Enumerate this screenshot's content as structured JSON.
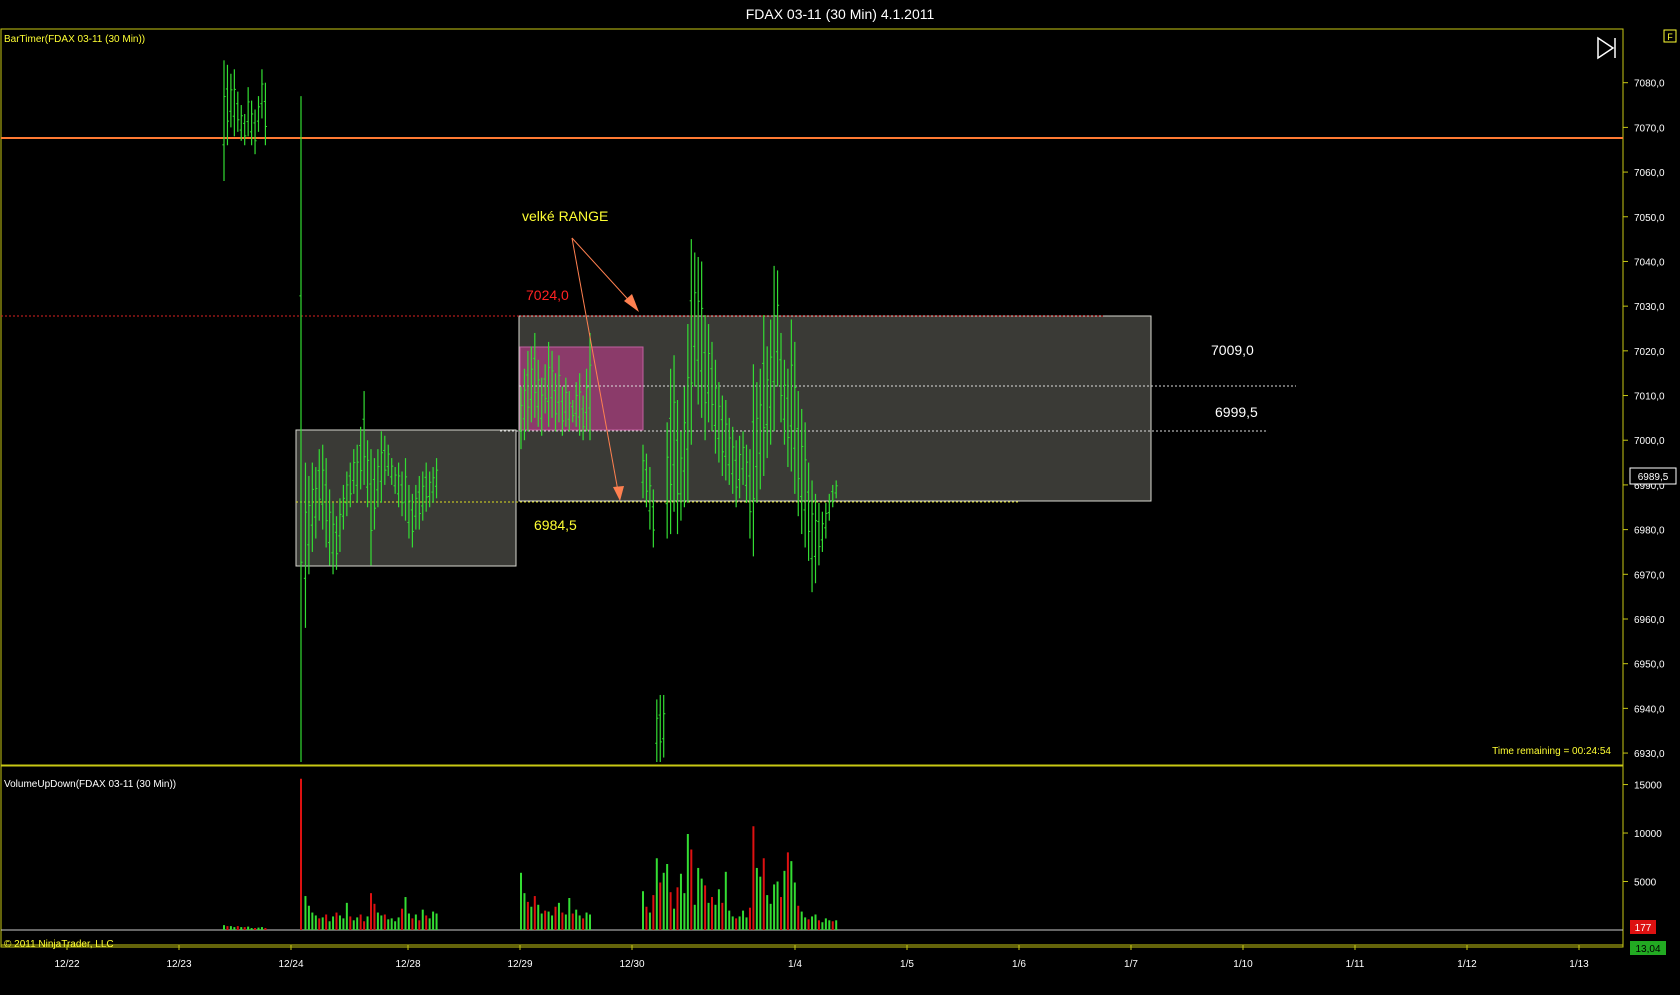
{
  "window_title": "FDAX 03-11 (30 Min)  4.1.2011",
  "copyright": "© 2011 NinjaTrader, LLC",
  "colors": {
    "background": "#000000",
    "frame": "#c8c814",
    "up_bar": "#33dd33",
    "down_bar": "#dd1111",
    "orange_line": "#ff7a33",
    "red_dotted": "#dd2222",
    "label_yellow": "#ffff33",
    "label_red": "#ff2222",
    "range_fill": "#444440",
    "pink_fill": "#a03c78",
    "arrow": "#ff8050"
  },
  "price_panel": {
    "indicator_label": "BarTimer(FDAX 03-11 (30 Min))",
    "time_remaining": "Time remaining = 00:24:54",
    "current_price": "6989,5",
    "yaxis_ticks": [
      "7080,0",
      "7070,0",
      "7060,0",
      "7050,0",
      "7040,0",
      "7030,0",
      "7020,0",
      "7010,0",
      "7000,0",
      "6990,0",
      "6980,0",
      "6970,0",
      "6960,0",
      "6950,0",
      "6940,0",
      "6930,0"
    ],
    "ylim": [
      6928,
      7090
    ],
    "annotation_text": "velké RANGE",
    "level_labels": {
      "high": "7024,0",
      "mid": "7009,0",
      "low_mid": "6999,5",
      "low": "6984,5"
    },
    "levels": {
      "orange": 7062.5,
      "high": 7024.0,
      "mid": 7009.0,
      "low_mid": 6999.5,
      "low": 6984.5
    },
    "menu_glyph": "F"
  },
  "volume_panel": {
    "indicator_label": "VolumeUpDown(FDAX 03-11 (30 Min))",
    "yaxis_ticks": [
      "15000",
      "10000",
      "5000"
    ],
    "ylim": [
      0,
      16500
    ],
    "current_volume": "177",
    "bottom_value": "13,04"
  },
  "xaxis_labels": [
    "12/22",
    "12/23",
    "12/24",
    "12/28",
    "12/29",
    "12/30",
    "1/4",
    "1/5",
    "1/6",
    "1/7",
    "1/10",
    "1/11",
    "1/12",
    "1/13"
  ],
  "chart_data": {
    "type": "bar",
    "title": "FDAX 03-11 (30 Min)  4.1.2011",
    "price_ylim": [
      6928,
      7090
    ],
    "volume_ylim": [
      0,
      16500
    ],
    "segments": [
      {
        "date": "12/23",
        "highs": [
          7085,
          7084,
          7082,
          7083,
          7078,
          7075,
          7073,
          7079,
          7076,
          7074,
          7077,
          7083,
          7080
        ],
        "lows": [
          7058,
          7066,
          7070,
          7068,
          7069,
          7067,
          7066,
          7068,
          7066,
          7064,
          7069,
          7072,
          7066
        ],
        "volumes": [
          500,
          400,
          400,
          300,
          400,
          300,
          300,
          350,
          200,
          200,
          250,
          300,
          200
        ],
        "up": [
          true,
          false,
          true,
          true,
          false,
          true,
          false,
          true,
          true,
          false,
          true,
          true,
          false
        ]
      },
      {
        "date": "12/24",
        "highs": [
          7077,
          6995,
          6992,
          6995,
          6994,
          6998,
          6999,
          6996,
          6989,
          6986,
          6983,
          6987,
          6990,
          6993,
          6995,
          6998,
          6999,
          7003,
          7011,
          7000,
          6998,
          6996,
          6998,
          7002,
          7001,
          6999,
          6996,
          6994,
          6995,
          6993,
          6996,
          6990,
          6988,
          6990,
          6992,
          6993,
          6995,
          6993,
          6994,
          6996
        ],
        "lows": [
          6928,
          6958,
          6970,
          6975,
          6978,
          6982,
          6980,
          6976,
          6972,
          6970,
          6971,
          6975,
          6980,
          6983,
          6985,
          6988,
          6986,
          6989,
          6990,
          6985,
          6972,
          6980,
          6985,
          6986,
          6990,
          6992,
          6990,
          6988,
          6985,
          6983,
          6982,
          6978,
          6976,
          6980,
          6980,
          6982,
          6984,
          6985,
          6986,
          6987
        ],
        "volumes": [
          15600,
          3500,
          2500,
          1800,
          1500,
          1200,
          1300,
          1600,
          900,
          1400,
          1800,
          1500,
          1200,
          2800,
          1400,
          1000,
          1300,
          1600,
          900,
          1400,
          3800,
          2700,
          1800,
          1500,
          1600,
          1100,
          1200,
          900,
          1300,
          2200,
          3400,
          1700,
          1200,
          1600,
          1000,
          2100,
          1500,
          1200,
          1900,
          1700
        ],
        "up": [
          false,
          true,
          true,
          true,
          true,
          false,
          true,
          false,
          true,
          true,
          false,
          true,
          true,
          true,
          false,
          true,
          true,
          false,
          false,
          true,
          false,
          false,
          true,
          true,
          false,
          true,
          true,
          true,
          true,
          false,
          true,
          true,
          false,
          true,
          false,
          true,
          false,
          true,
          true,
          true
        ]
      },
      {
        "date": "12/29",
        "highs": [
          7012,
          7016,
          7020,
          7021,
          7024,
          7018,
          7014,
          7017,
          7022,
          7020,
          7015,
          7019,
          7012,
          7014,
          7011,
          7009,
          7013,
          7015,
          7010,
          7016,
          7024
        ],
        "lows": [
          6998,
          7000,
          7002,
          7004,
          7005,
          7003,
          7001,
          7006,
          7003,
          7005,
          7002,
          7004,
          7001,
          7003,
          7002,
          7004,
          7003,
          7001,
          7000,
          7002,
          7000
        ],
        "volumes": [
          5900,
          3800,
          2900,
          2400,
          3500,
          2600,
          1700,
          2000,
          1900,
          1500,
          2400,
          2800,
          1800,
          1600,
          3300,
          1700,
          2100,
          1500,
          1200,
          1800,
          1600
        ],
        "up": [
          true,
          true,
          false,
          true,
          false,
          true,
          true,
          false,
          true,
          true,
          false,
          true,
          false,
          true,
          true,
          false,
          true,
          true,
          false,
          true,
          true
        ]
      },
      {
        "date": "12/30",
        "highs": [
          6999,
          6997,
          6994,
          6989,
          6942,
          6943,
          6943,
          7004,
          7016,
          7019,
          7009,
          7002,
          7012,
          7026,
          7045,
          7042,
          7041,
          7040,
          7028,
          7026,
          7022,
          7018,
          7013,
          7010,
          7009,
          7005,
          7003,
          7000,
          7001,
          7002,
          6999,
          6998,
          7017,
          7013,
          7016,
          7028,
          7021,
          7027,
          7039,
          7038,
          7024,
          7018,
          7016,
          7027,
          7022,
          7011,
          7007,
          7004,
          6995,
          6991,
          6988,
          6986,
          6984,
          6986,
          6988,
          6990,
          6991
        ],
        "lows": [
          6987,
          6985,
          6980,
          6976,
          6928,
          6928,
          6929,
          6978,
          6979,
          6984,
          6979,
          6982,
          6985,
          6986,
          6999,
          7012,
          7008,
          7005,
          7000,
          7004,
          7002,
          6997,
          6995,
          6992,
          6991,
          6990,
          6988,
          6985,
          6987,
          6990,
          6986,
          6978,
          6974,
          6986,
          6989,
          6992,
          6996,
          6999,
          7002,
          7012,
          7004,
          6999,
          6994,
          6993,
          6988,
          6983,
          6979,
          6976,
          6973,
          6966,
          6968,
          6972,
          6975,
          6978,
          6982,
          6985,
          6987
        ],
        "volumes": [
          4000,
          2400,
          1800,
          3600,
          7400,
          4900,
          5900,
          6800,
          3900,
          2200,
          4400,
          5800,
          3800,
          9900,
          8300,
          2600,
          6400,
          5300,
          4600,
          2800,
          3400,
          2600,
          4200,
          2800,
          6000,
          2000,
          1400,
          1200,
          1400,
          2000,
          1300,
          2300,
          10700,
          6400,
          5500,
          7400,
          3600,
          2700,
          4700,
          5000,
          3400,
          6100,
          8000,
          7100,
          4900,
          2500,
          1900,
          1300,
          1100,
          1400,
          1600,
          1000,
          800,
          1200,
          1000,
          900,
          1000
        ],
        "up": [
          true,
          false,
          true,
          false,
          true,
          false,
          true,
          true,
          false,
          true,
          false,
          true,
          true,
          true,
          false,
          true,
          true,
          true,
          false,
          true,
          false,
          true,
          true,
          false,
          true,
          true,
          true,
          false,
          true,
          true,
          true,
          false,
          false,
          true,
          true,
          false,
          true,
          true,
          true,
          true,
          false,
          true,
          false,
          true,
          true,
          false,
          true,
          true,
          false,
          true,
          true,
          false,
          true,
          true,
          true,
          false,
          true
        ]
      }
    ]
  }
}
